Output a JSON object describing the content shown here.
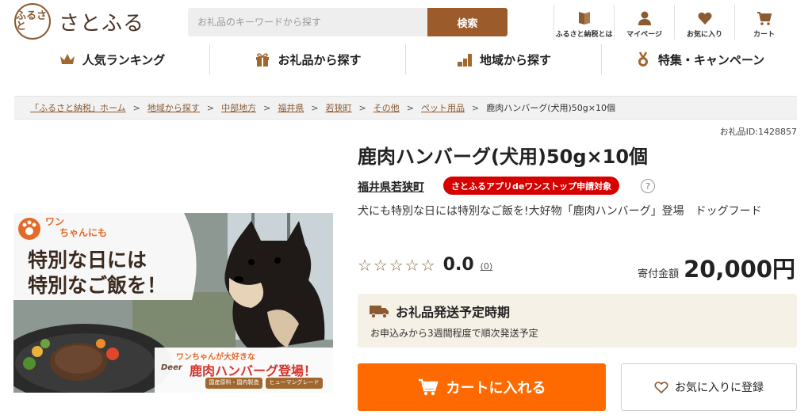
{
  "header": {
    "logo_mark": "ふるさと",
    "logo_text": "さとふる",
    "search_placeholder": "お礼品のキーワードから探す",
    "search_button": "検索",
    "nav": [
      {
        "label": "ふるさと納税とは",
        "icon": "book-icon"
      },
      {
        "label": "マイページ",
        "icon": "user-icon"
      },
      {
        "label": "お気に入り",
        "icon": "heart-icon"
      },
      {
        "label": "カート",
        "icon": "cart-icon"
      }
    ]
  },
  "main_nav": [
    {
      "label": "人気ランキング",
      "icon": "crown-icon"
    },
    {
      "label": "お礼品から探す",
      "icon": "gift-icon"
    },
    {
      "label": "地域から探す",
      "icon": "region-icon"
    },
    {
      "label": "特集・キャンペーン",
      "icon": "medal-icon"
    }
  ],
  "breadcrumb": [
    "「ふるさと納税」ホーム",
    "地域から探す",
    "中部地方",
    "福井県",
    "若狭町",
    "その他",
    "ペット用品"
  ],
  "breadcrumb_current": "鹿肉ハンバーグ(犬用)50g×10個",
  "item_id": "お礼品ID:1428857",
  "product": {
    "title": "鹿肉ハンバーグ(犬用)50g×10個",
    "region": "福井県若狭町",
    "app_badge": "さとふるアプリdeワンストップ申請対象",
    "help": "?",
    "description": "犬にも特別な日には特別なご飯を!大好物「鹿肉ハンバーグ」登場　ドッグフード",
    "stars": "☆☆☆☆☆",
    "rating": "0.0",
    "review_count": "(0)",
    "price_label": "寄付金額",
    "price": "20,000円"
  },
  "image": {
    "tag_top": "ワン",
    "tag_bottom": "ちゃんにも",
    "headline_1": "特別な日には",
    "headline_2": "特別なご飯を！",
    "sub_caption": "ワンちゃんが大好きな",
    "main_caption": "鹿肉ハンバーグ登場！",
    "brand": "Deer",
    "pill_1": "国産原料・国内製造",
    "pill_2": "ヒューマングレード"
  },
  "shipping": {
    "title": "お礼品発送予定時期",
    "text": "お申込みから3週間程度で順次発送予定"
  },
  "actions": {
    "cart": "カートに入れる",
    "favorite": "お気に入りに登録"
  },
  "colors": {
    "brand_brown": "#9b5b2a",
    "cart_orange": "#ff6a00",
    "badge_red": "#d60000",
    "shipping_bg": "#f6f1e6"
  }
}
